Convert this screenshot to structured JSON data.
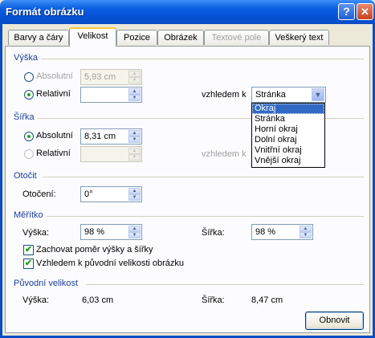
{
  "window": {
    "title": "Formát obrázku"
  },
  "tabs": [
    "Barvy a čáry",
    "Velikost",
    "Pozice",
    "Obrázek",
    "Textové pole",
    "Veškerý text"
  ],
  "height_section": {
    "title": "Výška",
    "absolute_label": "Absolutní",
    "absolute_value": "5,93 cm",
    "relative_label": "Relativní",
    "relative_value": "",
    "relative_to_label": "vzhledem k",
    "relative_to_value": "Stránka",
    "dropdown_options": [
      "Okraj",
      "Stránka",
      "Horní okraj",
      "Dolní okraj",
      "Vnitřní okraj",
      "Vnější okraj"
    ]
  },
  "width_section": {
    "title": "Šířka",
    "absolute_label": "Absolutní",
    "absolute_value": "8,31 cm",
    "relative_label": "Relativní",
    "relative_value": "",
    "relative_to_label": "vzhledem k"
  },
  "rotate_section": {
    "title": "Otočit",
    "rotation_label": "Otočení:",
    "rotation_value": "0°"
  },
  "scale_section": {
    "title": "Měřítko",
    "height_label": "Výška:",
    "height_value": "98 %",
    "width_label": "Šířka:",
    "width_value": "98 %",
    "lock_aspect_label": "Zachovat poměr výšky a šířky",
    "lock_aspect_checked": true,
    "relative_original_label": "Vzhledem k původní velikosti obrázku",
    "relative_original_checked": true
  },
  "original_section": {
    "title": "Původní velikost",
    "height_label": "Výška:",
    "height_value": "6,03 cm",
    "width_label": "Šířka:",
    "width_value": "8,47 cm"
  },
  "buttons": {
    "reset": "Obnovit",
    "help": "?",
    "close": "✕"
  }
}
